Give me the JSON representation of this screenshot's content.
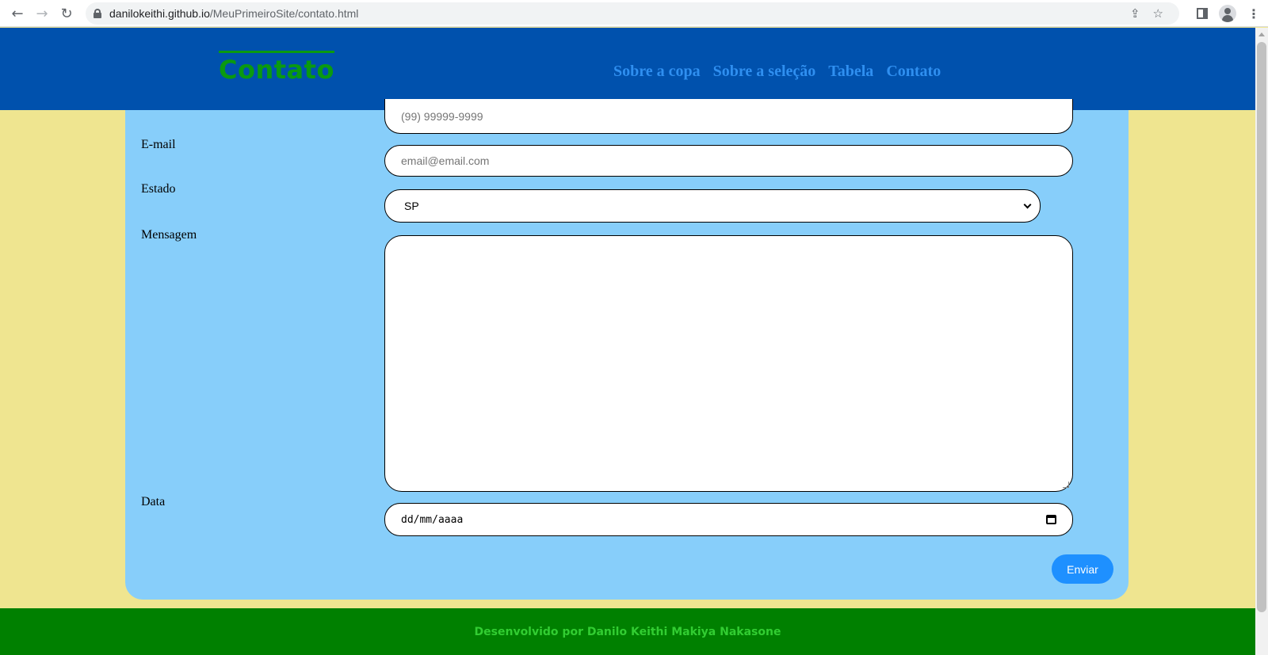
{
  "browser": {
    "url_host": "danilokeithi.github.io",
    "url_path": "/MeuPrimeiroSite/contato.html",
    "icons": [
      "back-icon",
      "forward-icon",
      "reload-icon",
      "lock-icon",
      "share-icon",
      "star-icon",
      "side-panel-icon",
      "profile-icon",
      "menu-icon"
    ]
  },
  "header": {
    "brand": "Contato",
    "nav": [
      "Sobre a copa",
      "Sobre a seleção",
      "Tabela",
      "Contato"
    ]
  },
  "form": {
    "phone_placeholder": "(99) 99999-9999",
    "email_label": "E-mail",
    "email_placeholder": "email@email.com",
    "state_label": "Estado",
    "state_value": "SP",
    "message_label": "Mensagem",
    "date_label": "Data",
    "date_placeholder": "dd/mm/aaaa",
    "submit_label": "Enviar"
  },
  "footer": {
    "text": "Desenvolvido por Danilo Keithi Makiya Nakasone"
  },
  "colors": {
    "header_bg": "#0051ad",
    "brand": "#0a9a10",
    "nav_link": "#2f8ff0",
    "page_bg": "#efe590",
    "panel_bg": "#87cefa",
    "button_bg": "#1e90ff",
    "footer_bg": "#008000",
    "footer_text": "#32cd32"
  }
}
